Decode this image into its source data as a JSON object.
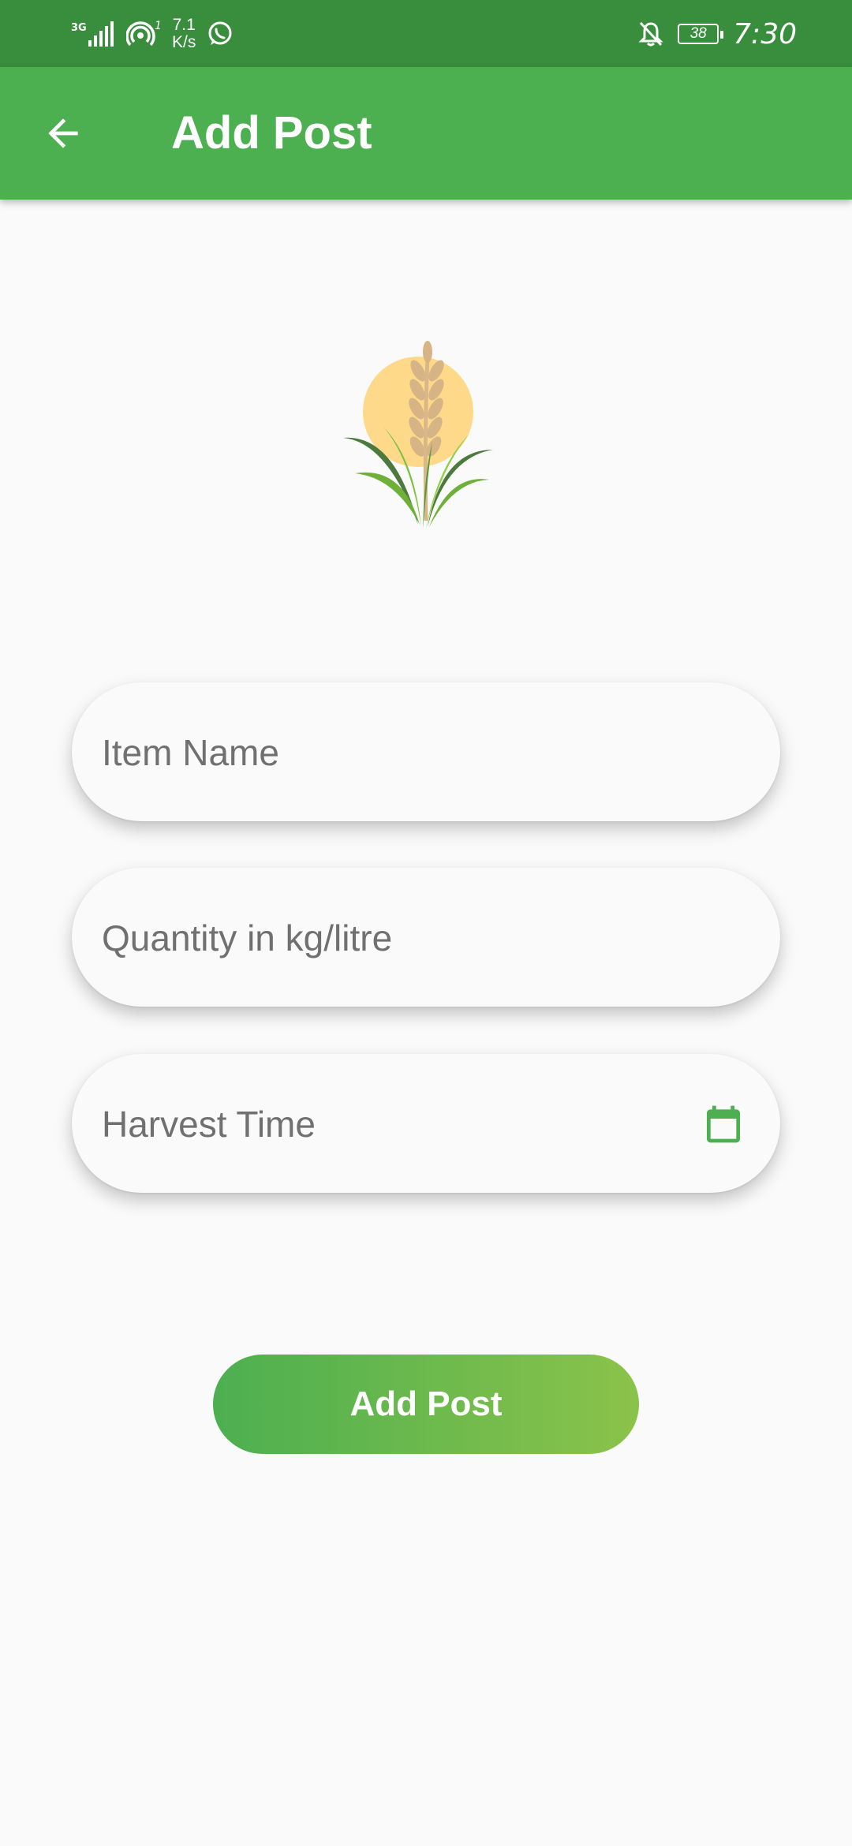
{
  "status_bar": {
    "network": "3G",
    "hotspot_count": "1",
    "speed_value": "7.1",
    "speed_unit": "K/s",
    "battery": "38",
    "time": "7:30"
  },
  "app_bar": {
    "title": "Add Post",
    "back_icon": "arrow-back-icon"
  },
  "logo": {
    "icon": "wheat-plant-logo"
  },
  "form": {
    "item_name_placeholder": "Item Name",
    "quantity_placeholder": "Quantity in kg/litre",
    "harvest_time_placeholder": "Harvest Time",
    "calendar_icon": "calendar-icon"
  },
  "submit": {
    "label": "Add Post"
  },
  "colors": {
    "status_bar": "#388e3c",
    "app_bar": "#4caf50",
    "gradient_start": "#4caf50",
    "gradient_end": "#8bc34a",
    "accent_icon": "#4caf50"
  }
}
